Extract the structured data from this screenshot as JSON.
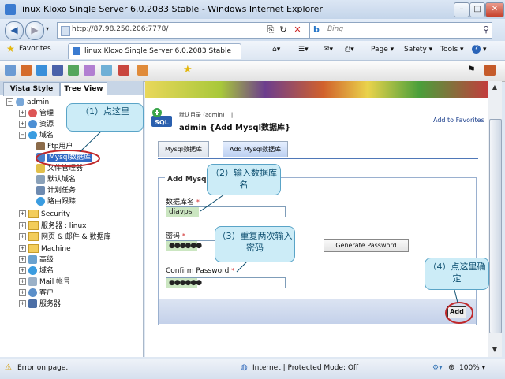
{
  "window": {
    "title": "linux Kloxo Single Server 6.0.2083 Stable - Windows Internet Explorer"
  },
  "addressbar": {
    "url": "http://87.98.250.206:7778/",
    "search_provider": "b",
    "search_placeholder": "Bing"
  },
  "favorites_bar": {
    "favorites_label": "Favorites",
    "tab_title": "linux Kloxo Single Server 6.0.2083 Stable"
  },
  "commandbar": {
    "page": "Page ▾",
    "safety": "Safety ▾",
    "tools": "Tools ▾",
    "help": "?"
  },
  "left_panel": {
    "tabs": [
      "Vista Style",
      "Tree View"
    ],
    "tree": {
      "root": "admin",
      "items": [
        "管理",
        "资源",
        "域名",
        "Ftp用户",
        "Mysql数据库",
        "文件管理器",
        "默认域名",
        "计划任务",
        "路由跟踪",
        "Security",
        "服务器 : linux",
        "网页 & 邮件 & 数据库",
        "Machine",
        "高级",
        "域名",
        "Mail 帐号",
        "客户",
        "服务器"
      ]
    }
  },
  "main": {
    "logo_text": "SQL",
    "breadcrumb_prefix": "默认目录",
    "breadcrumb_user": "(admin)",
    "breadcrumb_sep": "|",
    "title": "admin {Add Mysql数据库}",
    "add_to_favorites": "Add to Favorites",
    "tabs": [
      "Mysql数据库",
      "Add Mysql数据库"
    ],
    "legend": "Add Mysql数",
    "fields": {
      "dbname_label": "数据库名",
      "dbname_value": "diavps",
      "password_label": "密码",
      "password_mask": "●●●●●●",
      "confirm_label": "Confirm Password",
      "confirm_mask": "●●●●●●",
      "required_mark": "*"
    },
    "generate_password": "Generate Password",
    "add_button": "Add"
  },
  "callouts": {
    "c1": "（1）点这里",
    "c2": "（2）输入数据库名",
    "c3": "（3）重复两次输入密码",
    "c4": "（4）点这里确定"
  },
  "statusbar": {
    "left": "Error on page.",
    "zone": "Internet | Protected Mode: Off",
    "zoom": "100%"
  },
  "colors": {
    "accent": "#316ac5",
    "callout_bg": "#ccecf7",
    "annotation_red": "#c0282a"
  }
}
